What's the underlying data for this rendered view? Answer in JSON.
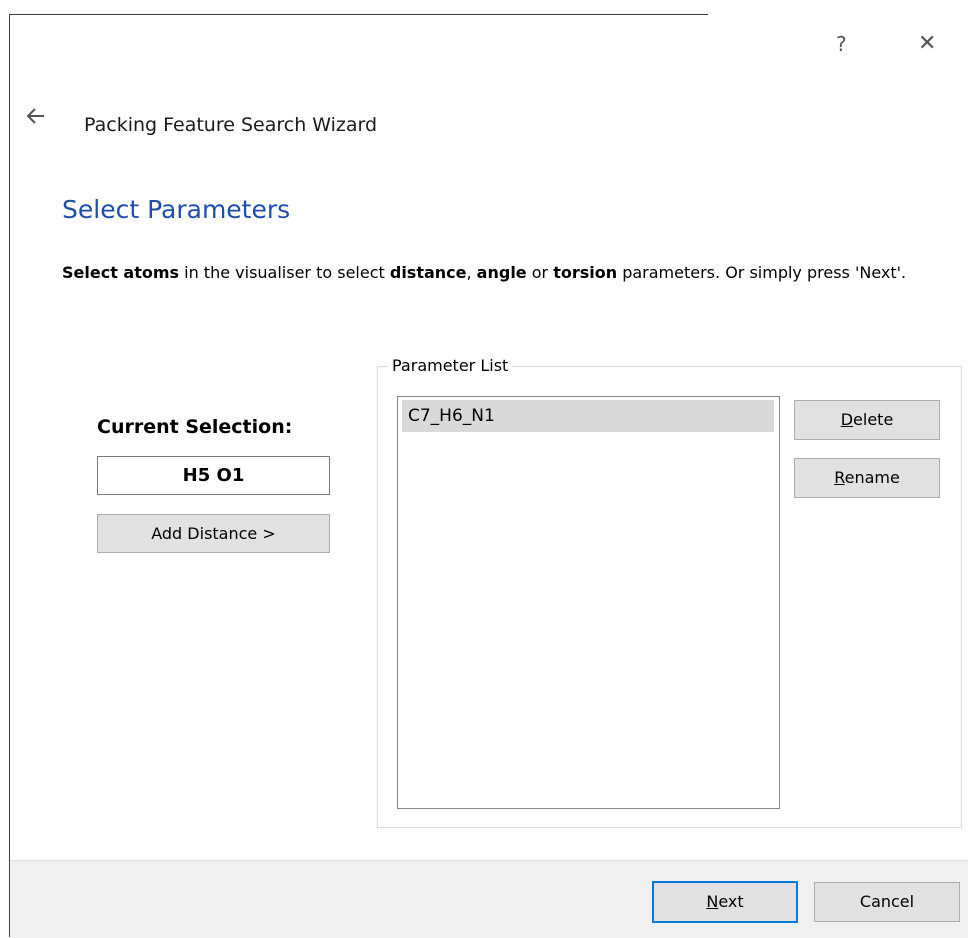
{
  "window": {
    "help_label": "?",
    "close_label": "✕",
    "behind_window_text": "·· ···· · ·"
  },
  "header": {
    "back_icon": "back-arrow-icon",
    "wizard_title": "Packing Feature Search Wizard"
  },
  "page": {
    "heading": "Select Parameters",
    "instructions": {
      "part1_bold": "Select atoms",
      "part2": " in the visualiser to select ",
      "part3_bold": "distance",
      "part4": ", ",
      "part5_bold": "angle",
      "part6": " or ",
      "part7_bold": "torsion",
      "part8": " parameters. Or simply press 'Next'."
    }
  },
  "selection": {
    "label": "Current Selection:",
    "value": "H5 O1",
    "add_button_label": "Add Distance >"
  },
  "parameter_list": {
    "group_label": "Parameter List",
    "items": [
      "C7_H6_N1"
    ],
    "delete_label_mnemonic": "D",
    "delete_label_rest": "elete",
    "rename_label_mnemonic": "R",
    "rename_label_rest": "ename"
  },
  "footer": {
    "next_label_mnemonic": "N",
    "next_label_rest": "ext",
    "cancel_label": "Cancel"
  },
  "colors": {
    "heading": "#1f4ea8",
    "default_button_border": "#0078d7",
    "button_face": "#e1e1e1",
    "footer_bg": "#f0f0f0",
    "selected_item_bg": "#d9d9d9"
  }
}
